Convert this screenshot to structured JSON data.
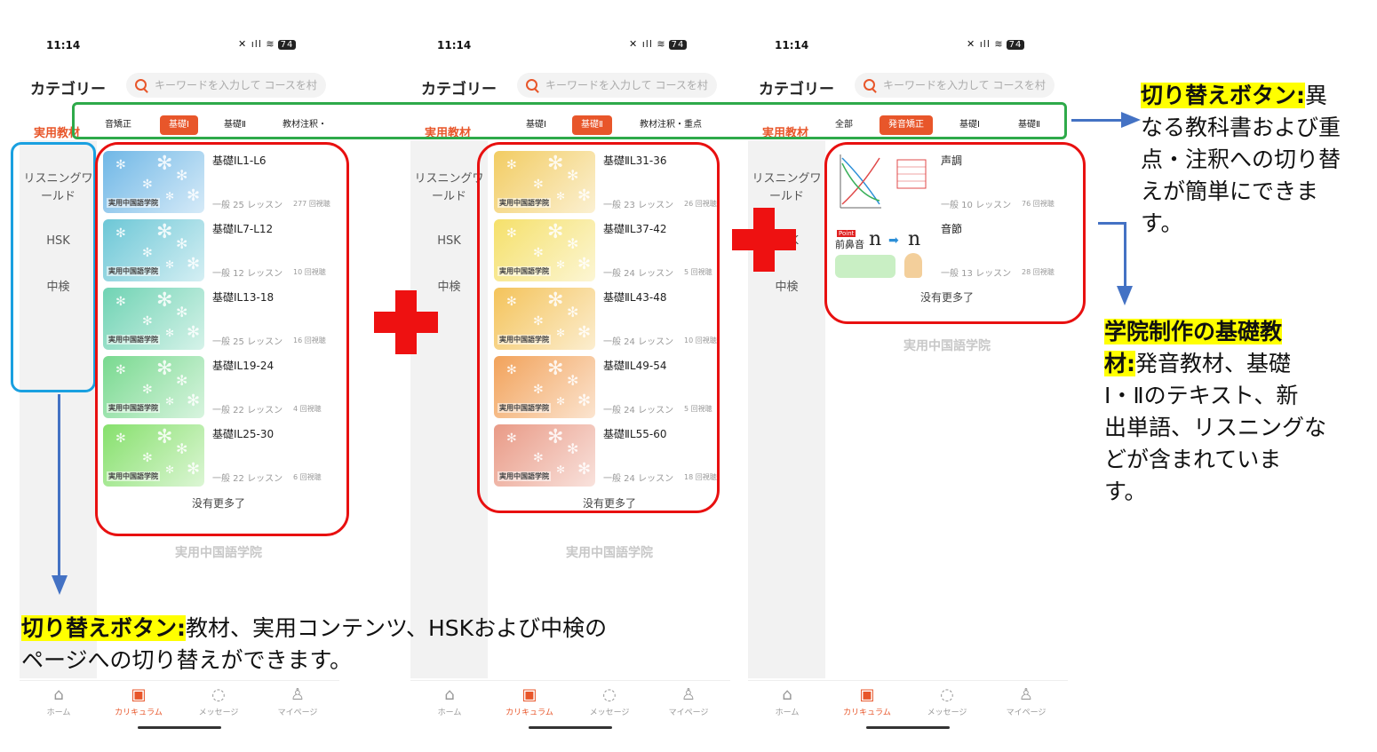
{
  "status": {
    "time": "11:14",
    "icons": "✉ ⊠ ⊛",
    "right": "✕ ıll ≋",
    "battery": "74"
  },
  "header": {
    "category_title": "カテゴリー",
    "search_placeholder": "キーワードを入力して コースを村"
  },
  "sidebar": {
    "active": "実用教材",
    "items": [
      "リスニングワ",
      "ールド",
      "HSK",
      "中検"
    ]
  },
  "nav": {
    "items": [
      {
        "label": "ホーム",
        "icon": "home-icon"
      },
      {
        "label": "カリキュラム",
        "icon": "calendar-icon"
      },
      {
        "label": "メッセージ",
        "icon": "chat-icon"
      },
      {
        "label": "マイページ",
        "icon": "user-icon"
      }
    ]
  },
  "screens": [
    {
      "tabs": [
        {
          "label": "音矯正"
        },
        {
          "label": "基礎Ⅰ",
          "active": true
        },
        {
          "label": "基礎Ⅱ"
        },
        {
          "label": "教材注釈・"
        }
      ],
      "courses": [
        {
          "title": "基礎ⅠL1-L6",
          "lessons": "一般 25 レッスン",
          "views": "277 回視聴",
          "color": "#6fb7e6"
        },
        {
          "title": "基礎ⅠL7-L12",
          "lessons": "一般 12 レッスン",
          "views": "10 回視聴",
          "color": "#6cc7d6"
        },
        {
          "title": "基礎ⅠL13-18",
          "lessons": "一般 25 レッスン",
          "views": "16 回視聴",
          "color": "#6fd3b3"
        },
        {
          "title": "基礎ⅠL19-24",
          "lessons": "一般 22 レッスン",
          "views": "4 回視聴",
          "color": "#78d98f"
        },
        {
          "title": "基礎ⅠL25-30",
          "lessons": "一般 22 レッスン",
          "views": "6 回視聴",
          "color": "#86e06c"
        }
      ]
    },
    {
      "tabs": [
        {
          "label": "基礎Ⅰ"
        },
        {
          "label": "基礎Ⅱ",
          "active": true
        },
        {
          "label": "教材注釈・重点"
        }
      ],
      "courses": [
        {
          "title": "基礎ⅡL31-36",
          "lessons": "一般 23 レッスン",
          "views": "26 回視聴",
          "color": "#f2cc62"
        },
        {
          "title": "基礎ⅡL37-42",
          "lessons": "一般 24 レッスン",
          "views": "5 回視聴",
          "color": "#f5e06a"
        },
        {
          "title": "基礎ⅡL43-48",
          "lessons": "一般 24 レッスン",
          "views": "10 回視聴",
          "color": "#f4c35a"
        },
        {
          "title": "基礎ⅡL49-54",
          "lessons": "一般 24 レッスン",
          "views": "5 回視聴",
          "color": "#f2a25a"
        },
        {
          "title": "基礎ⅡL55-60",
          "lessons": "一般 24 レッスン",
          "views": "18 回視聴",
          "color": "#e99a86"
        }
      ]
    },
    {
      "tabs": [
        {
          "label": "全部"
        },
        {
          "label": "発音矯正",
          "active": true
        },
        {
          "label": "基礎Ⅰ"
        },
        {
          "label": "基礎Ⅱ"
        }
      ],
      "courses": [
        {
          "title": "声調",
          "lessons": "一般 10 レッスン",
          "views": "76 回視聴"
        },
        {
          "title": "音節",
          "lessons": "一般 13 レッスン",
          "views": "28 回視聴"
        }
      ]
    }
  ],
  "thumb_label": "実用中国語学院",
  "nomore": "没有更多了",
  "brand": "実用中国語学院",
  "voice_thumb": {
    "point": "Point",
    "label": "前鼻音",
    "n": "n"
  },
  "annotations": {
    "a1_hl": "切り替えボタン:",
    "a1_text": "教材、実用コンテンツ、HSKおよび中検の",
    "a1_text2": "ページへの切り替えができます。",
    "a2_hl": "切り替えボタン:",
    "a2_text": "異",
    "a2_lines": [
      "なる教科書および重",
      "点・注釈への切り替",
      "えが簡単にできま",
      "す。"
    ],
    "a3_hl1": "学院制作の基礎教",
    "a3_hl2": "材:",
    "a3_text": "発音教材、基礎",
    "a3_lines": [
      "Ⅰ・Ⅱのテキスト、新",
      "出単語、リスニングな",
      "どが含まれていま",
      "す。"
    ]
  },
  "colors": {
    "accent": "#e8562a",
    "red_frame": "#e81010",
    "green_frame": "#2eaa4a",
    "blue_frame": "#1aa0e0",
    "arrow": "#4472c4"
  }
}
